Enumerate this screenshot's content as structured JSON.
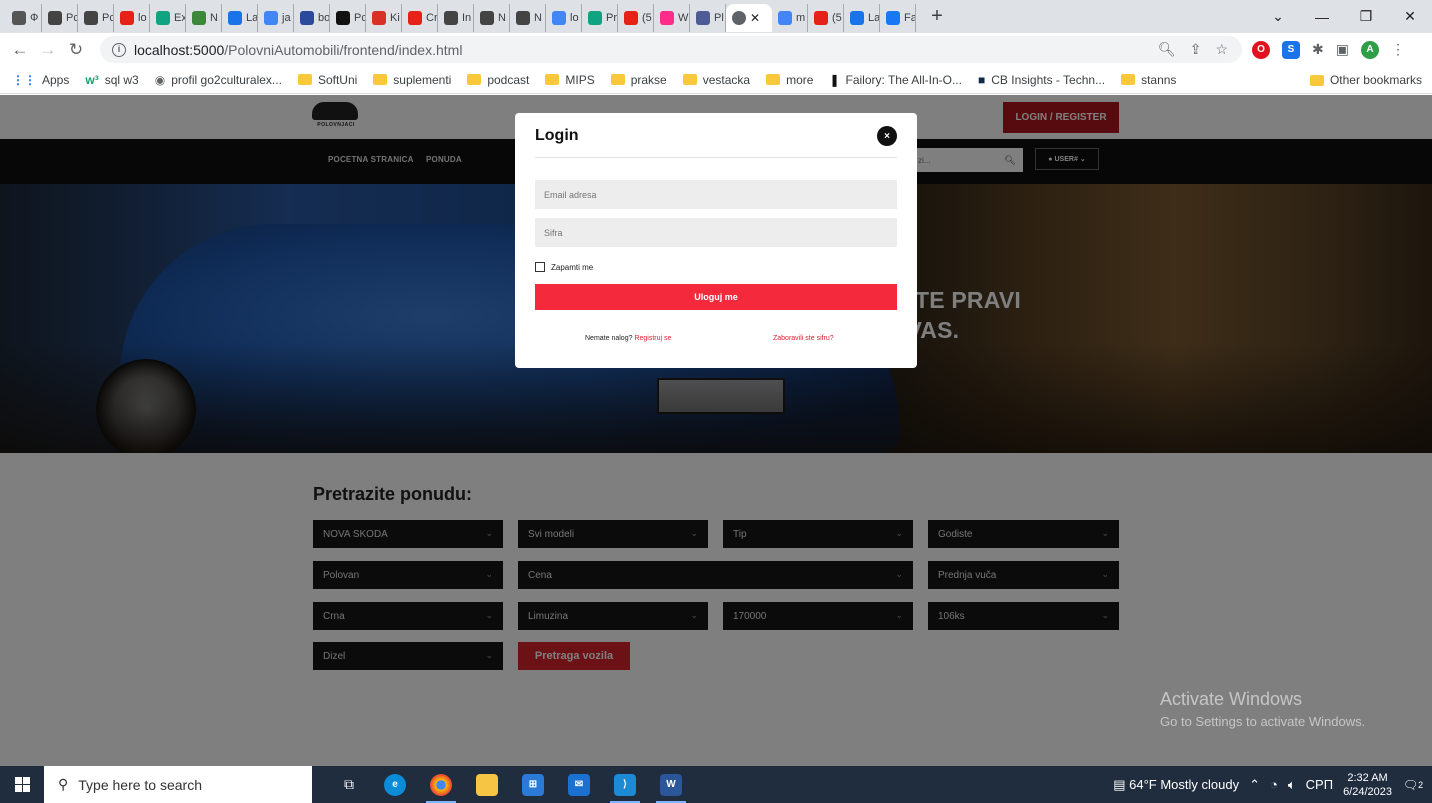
{
  "browser": {
    "tabs": [
      {
        "label": "Ф",
        "color": "#555"
      },
      {
        "label": "Pc",
        "color": "#444"
      },
      {
        "label": "Pc",
        "color": "#444"
      },
      {
        "label": "lo",
        "color": "#e62117"
      },
      {
        "label": "Ex",
        "color": "#10a37f"
      },
      {
        "label": "N",
        "color": "#3c873a"
      },
      {
        "label": "La",
        "color": "#1a73e8"
      },
      {
        "label": "ja",
        "color": "#4285f4"
      },
      {
        "label": "bo",
        "color": "#2b4a9c"
      },
      {
        "label": "Pc",
        "color": "#111"
      },
      {
        "label": "Ki",
        "color": "#d93025"
      },
      {
        "label": "Cr",
        "color": "#e62117"
      },
      {
        "label": "In",
        "color": "#444"
      },
      {
        "label": "N",
        "color": "#444"
      },
      {
        "label": "N",
        "color": "#444"
      },
      {
        "label": "lo",
        "color": "#4285f4"
      },
      {
        "label": "Pr",
        "color": "#10a37f"
      },
      {
        "label": "(5",
        "color": "#e62117"
      },
      {
        "label": "W",
        "color": "#ff2d8a"
      },
      {
        "label": "Pl",
        "color": "#4f5b93"
      },
      {
        "label": "m",
        "color": "#4285f4"
      },
      {
        "label": "(5",
        "color": "#e62117"
      },
      {
        "label": "La",
        "color": "#1a73e8"
      },
      {
        "label": "Fa",
        "color": "#1877f2"
      }
    ],
    "new_tab_label": "+",
    "url_host": "localhost:5000",
    "url_path": "/PolovniAutomobili/frontend/index.html",
    "bookmarks": [
      {
        "label": "Apps",
        "kind": "apps"
      },
      {
        "label": "sql w3",
        "kind": "w3"
      },
      {
        "label": "profil go2culturalex...",
        "kind": "globe"
      },
      {
        "label": "SoftUni",
        "kind": "folder"
      },
      {
        "label": "suplementi",
        "kind": "folder"
      },
      {
        "label": "podcast",
        "kind": "folder"
      },
      {
        "label": "MIPS",
        "kind": "folder"
      },
      {
        "label": "prakse",
        "kind": "folder"
      },
      {
        "label": "vestacka",
        "kind": "folder"
      },
      {
        "label": "more",
        "kind": "folder"
      },
      {
        "label": "Failory: The All-In-O...",
        "kind": "failory"
      },
      {
        "label": "CB Insights - Techn...",
        "kind": "cb"
      },
      {
        "label": "stanns",
        "kind": "folder"
      }
    ],
    "other_bookmarks": "Other bookmarks",
    "profile_initial": "A"
  },
  "site": {
    "logo_text": "POLOVNJACI",
    "login_register": "LOGIN / REGISTER",
    "nav": [
      "POCETNA STRANICA",
      "PONUDA"
    ],
    "search_placeholder": "zi...",
    "user_dropdown": "USER#",
    "hero_heading_line1": "NADJITE PRAVI",
    "hero_heading_line2": "O ZA VAS.",
    "search_title": "Pretrazite ponudu:",
    "filters": [
      [
        "NOVA SKODA",
        "Svi modeli",
        "Tip",
        "Godiste"
      ],
      [
        "Polovan",
        "Cena",
        "Prednja vuča"
      ],
      [
        "Crna",
        "Limuzina",
        "170000",
        "106ks"
      ],
      [
        "Dizel"
      ]
    ],
    "search_button": "Pretraga vozila"
  },
  "modal": {
    "title": "Login",
    "close": "×",
    "email_placeholder": "Email adresa",
    "password_placeholder": "Sifra",
    "remember_label": "Zapamti me",
    "submit_label": "Uloguj me",
    "no_account_text": "Nemate nalog?",
    "register_link": "Registruj se",
    "forgot_link": "Zaboravili ste sifru?"
  },
  "watermark": {
    "line1": "Activate Windows",
    "line2": "Go to Settings to activate Windows."
  },
  "taskbar": {
    "search_placeholder": "Type here to search",
    "weather": "64°F  Mostly cloudy",
    "language": "СРП",
    "time": "2:32 AM",
    "date": "6/24/2023",
    "notification_count": "2"
  }
}
